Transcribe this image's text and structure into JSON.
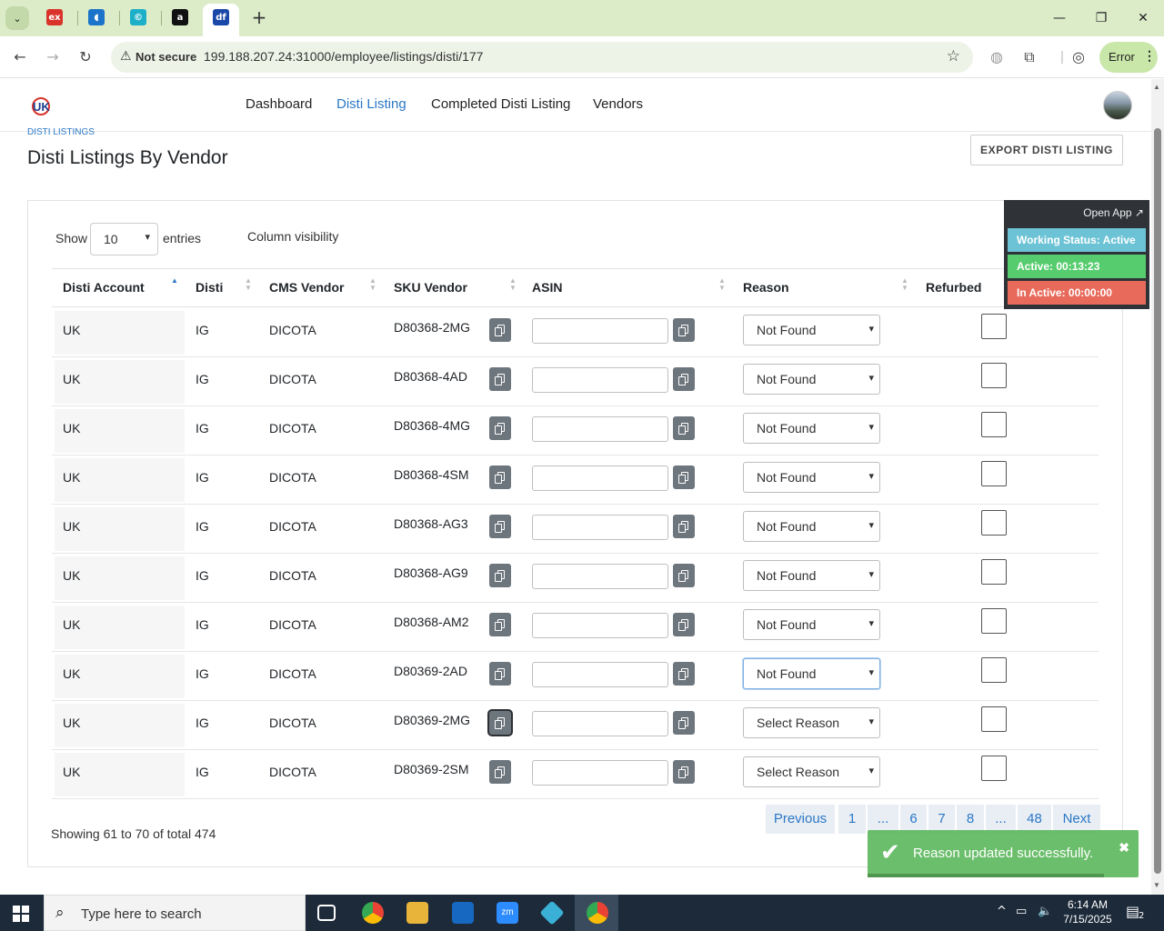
{
  "browser": {
    "tabs": [
      {
        "icon": "ex-tab-icon",
        "glyph": "ex",
        "color": "#d9332b"
      },
      {
        "icon": "blue-app-tab-icon",
        "glyph": "◖",
        "color": "#1b74c9"
      },
      {
        "icon": "copyright-tab-icon",
        "glyph": "©",
        "color": "#1cb0c8"
      },
      {
        "icon": "amazon-tab-icon",
        "glyph": "a",
        "color": "#111111"
      },
      {
        "icon": "df-tab-icon",
        "glyph": "df",
        "color": "#1948a8"
      }
    ],
    "security_label": "Not secure",
    "url": "199.188.207.24:31000/employee/listings/disti/177",
    "profile_status": "Error"
  },
  "app": {
    "nav": [
      "Dashboard",
      "Disti Listing",
      "Completed Disti Listing",
      "Vendors"
    ],
    "active_nav": "Disti Listing"
  },
  "page": {
    "breadcrumb": "Disti Listings",
    "title": "Disti Listings By Vendor",
    "export_label": "EXPORT DISTI LISTING",
    "show_label": "Show",
    "entries_value": "10",
    "entries_label": "entries",
    "column_visibility": "Column visibility",
    "info": "Showing 61 to 70 of total 474"
  },
  "table": {
    "columns": [
      "Disti Account",
      "Disti",
      "CMS Vendor",
      "SKU Vendor",
      "ASIN",
      "Reason",
      "Refurbed"
    ],
    "sorted_column": "Disti Account",
    "rows": [
      {
        "account": "UK",
        "disti": "IG",
        "cms_vendor": "DICOTA",
        "sku": "D80368-2MG",
        "asin": "",
        "reason": "Not Found",
        "refurbed": false
      },
      {
        "account": "UK",
        "disti": "IG",
        "cms_vendor": "DICOTA",
        "sku": "D80368-4AD",
        "asin": "",
        "reason": "Not Found",
        "refurbed": false
      },
      {
        "account": "UK",
        "disti": "IG",
        "cms_vendor": "DICOTA",
        "sku": "D80368-4MG",
        "asin": "",
        "reason": "Not Found",
        "refurbed": false
      },
      {
        "account": "UK",
        "disti": "IG",
        "cms_vendor": "DICOTA",
        "sku": "D80368-4SM",
        "asin": "",
        "reason": "Not Found",
        "refurbed": false
      },
      {
        "account": "UK",
        "disti": "IG",
        "cms_vendor": "DICOTA",
        "sku": "D80368-AG3",
        "asin": "",
        "reason": "Not Found",
        "refurbed": false
      },
      {
        "account": "UK",
        "disti": "IG",
        "cms_vendor": "DICOTA",
        "sku": "D80368-AG9",
        "asin": "",
        "reason": "Not Found",
        "refurbed": false
      },
      {
        "account": "UK",
        "disti": "IG",
        "cms_vendor": "DICOTA",
        "sku": "D80368-AM2",
        "asin": "",
        "reason": "Not Found",
        "refurbed": false
      },
      {
        "account": "UK",
        "disti": "IG",
        "cms_vendor": "DICOTA",
        "sku": "D80369-2AD",
        "asin": "",
        "reason": "Not Found",
        "refurbed": false
      },
      {
        "account": "UK",
        "disti": "IG",
        "cms_vendor": "DICOTA",
        "sku": "D80369-2MG",
        "asin": "",
        "reason": "Select Reason",
        "refurbed": false
      },
      {
        "account": "UK",
        "disti": "IG",
        "cms_vendor": "DICOTA",
        "sku": "D80369-2SM",
        "asin": "",
        "reason": "Select Reason",
        "refurbed": false
      }
    ]
  },
  "pagination": {
    "items": [
      "Previous",
      "1",
      "...",
      "6",
      "7",
      "8",
      "...",
      "48",
      "Next"
    ],
    "current": "7"
  },
  "work_status": {
    "open_app": "Open App ↗",
    "status": "Working Status: Active",
    "active": "Active: 00:13:23",
    "inactive": "In Active: 00:00:00",
    "colors": {
      "status": "#6cc3d5",
      "active": "#56cc6e",
      "inactive": "#e86a5b"
    }
  },
  "toast": {
    "message": "Reason updated successfully.",
    "close": "✖"
  },
  "taskbar": {
    "search_placeholder": "Type here to search",
    "time": "6:14 AM",
    "date": "7/15/2025",
    "notification_count": "2"
  },
  "colors": {
    "link": "#2b78c5",
    "chrome_tabstrip": "#dcecc9",
    "copy_button": "#6d757d",
    "toast": "#5cb85c"
  }
}
